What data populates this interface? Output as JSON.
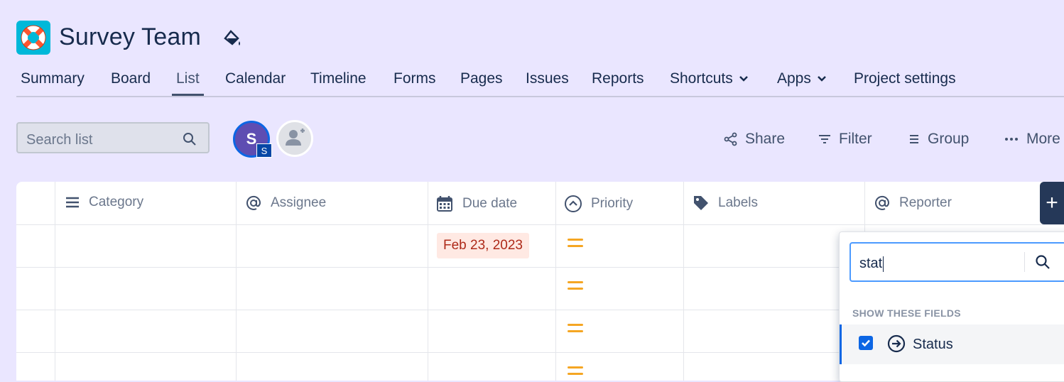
{
  "project": {
    "title": "Survey Team"
  },
  "nav": {
    "tabs": [
      "Summary",
      "Board",
      "List",
      "Calendar",
      "Timeline",
      "Forms",
      "Pages",
      "Issues",
      "Reports",
      "Shortcuts",
      "Apps",
      "Project settings"
    ],
    "active": "List"
  },
  "toolbar": {
    "search_placeholder": "Search list",
    "avatar_initial": "S",
    "avatar_badge": "S",
    "share_label": "Share",
    "filter_label": "Filter",
    "group_label": "Group",
    "more_label": "More"
  },
  "table": {
    "columns": [
      "Category",
      "Assignee",
      "Due date",
      "Priority",
      "Labels",
      "Reporter"
    ],
    "rows": [
      {
        "due_date": "Feb 23, 2023",
        "priority": "medium"
      },
      {
        "due_date": "",
        "priority": "medium"
      },
      {
        "due_date": "",
        "priority": "medium"
      },
      {
        "due_date": "",
        "priority": "medium"
      }
    ],
    "add_column_label": "+"
  },
  "field_picker": {
    "search_value": "stat",
    "section_label": "SHOW THESE FIELDS",
    "fields": [
      {
        "label": "Status",
        "checked": true
      }
    ]
  },
  "colors": {
    "page_background": "#eae6ff",
    "accent": "#0c66e4",
    "priority_medium": "#f5a623",
    "date_chip_bg": "#ffe9e3",
    "date_chip_text": "#ae2a19"
  },
  "icons": {
    "project": "lifebuoy-icon",
    "theme": "paint-bucket-icon",
    "search": "search-icon",
    "share": "share-icon",
    "filter": "filter-icon",
    "group": "group-icon",
    "more": "more-icon"
  }
}
